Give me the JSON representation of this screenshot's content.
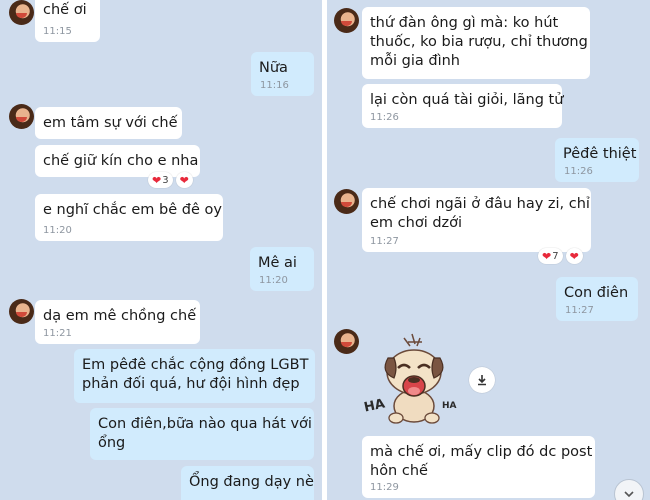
{
  "left": {
    "messages": [
      {
        "text": "chế ơi",
        "time": "11:15"
      },
      {
        "text": "Nữa",
        "time": "11:16"
      },
      {
        "text": "em tâm sự với chế"
      },
      {
        "text": "chế giữ kín cho e nha"
      },
      {
        "text": "e nghĩ chắc em bê đê oy",
        "time": "11:20"
      },
      {
        "text": "Mê ai",
        "time": "11:20"
      },
      {
        "text": "dạ em mê chồng chế",
        "time": "11:21"
      },
      {
        "lines": [
          "Em pêđê chắc cộng đồng LGBT",
          "phản đối quá, hư đội hình đẹp"
        ]
      },
      {
        "lines": [
          "Con điên,bữa nào qua hát với",
          "ổng"
        ]
      },
      {
        "text": "Ổng đang dạy nè"
      }
    ],
    "reaction": {
      "count": "3"
    }
  },
  "right": {
    "messages": [
      {
        "lines": [
          "thứ đàn ông gì mà: ko hút",
          "thuốc, ko bia rượu, chỉ thương",
          "mỗi gia đình"
        ]
      },
      {
        "text": "lại còn quá tài giỏi, lãng tử",
        "time": "11:26"
      },
      {
        "text": "Pêđê thiệt",
        "time": "11:26"
      },
      {
        "lines": [
          "chế chơi ngãi ở đâu hay zi, chỉ",
          "em chơi dzới"
        ],
        "time": "11:27"
      },
      {
        "text": "Con điên",
        "time": "11:27"
      },
      {
        "lines": [
          "mà chế ơi, mấy clip đó dc post",
          "hôn chế"
        ],
        "time": "11:29"
      }
    ],
    "reaction": {
      "count": "7"
    },
    "sticker": {
      "ha_left": "HA",
      "ha_right": "HA"
    }
  },
  "colors": {
    "background": "#cfdced",
    "incoming_bubble": "#ffffff",
    "outgoing_bubble": "#d1ebfd",
    "heart": "#e8293b"
  },
  "icons": {
    "reaction": "heart-icon",
    "sticker_action": "download-icon",
    "scroll": "chevron-down-icon"
  }
}
